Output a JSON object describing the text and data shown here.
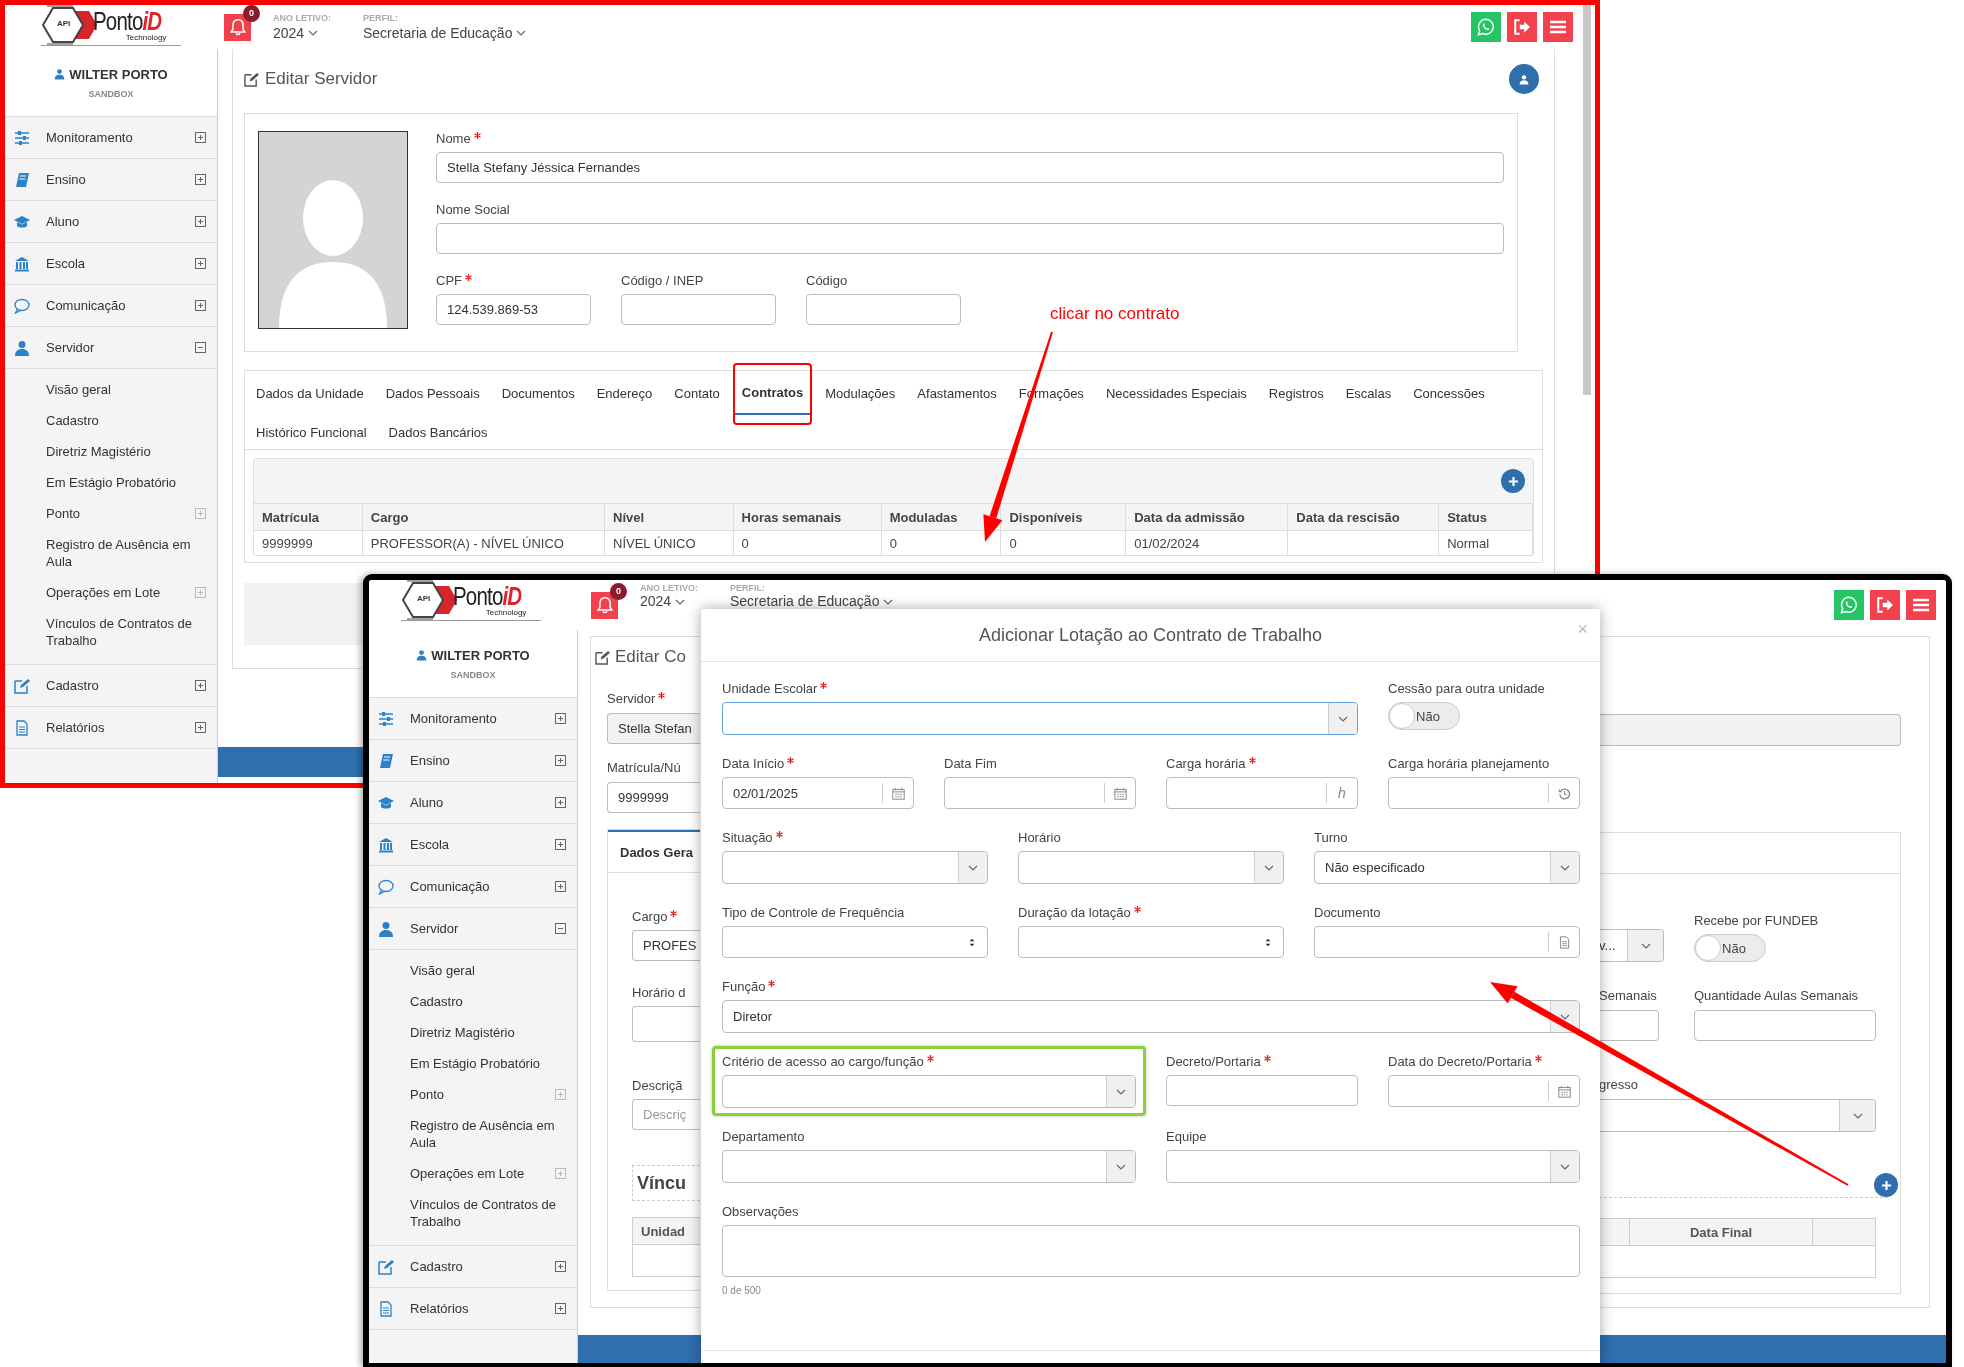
{
  "annotation": {
    "note": "clicar no contrato"
  },
  "back_screen": {
    "header": {
      "logo": {
        "badge": "API",
        "name": "Ponto",
        "accent": "iD",
        "tagline": "Technology"
      },
      "notifications": "0",
      "year_label": "ANO LETIVO:",
      "year": "2024",
      "profile_label": "PERFIL:",
      "profile": "Secretaria de Educação"
    },
    "sidebar": {
      "user": "WILTER PORTO",
      "environment": "SANDBOX",
      "items": [
        {
          "label": "Monitoramento",
          "expanded": false
        },
        {
          "label": "Ensino",
          "expanded": false
        },
        {
          "label": "Aluno",
          "expanded": false
        },
        {
          "label": "Escola",
          "expanded": false
        },
        {
          "label": "Comunicação",
          "expanded": false
        },
        {
          "label": "Servidor",
          "expanded": true,
          "children": [
            {
              "label": "Visão geral",
              "expandable": false
            },
            {
              "label": "Cadastro",
              "expandable": false
            },
            {
              "label": "Diretriz Magistério",
              "expandable": false
            },
            {
              "label": "Em Estágio Probatório",
              "expandable": false
            },
            {
              "label": "Ponto",
              "expandable": true
            },
            {
              "label": "Registro de Ausência em Aula",
              "expandable": false
            },
            {
              "label": "Operações em Lote",
              "expandable": true
            },
            {
              "label": "Vínculos de Contratos de Trabalho",
              "expandable": false
            }
          ]
        },
        {
          "label": "Cadastro",
          "expanded": false
        },
        {
          "label": "Relatórios",
          "expanded": false
        }
      ]
    },
    "page": {
      "title": "Editar Servidor",
      "fields": [
        {
          "label": "Nome",
          "required": true,
          "value": "Stella Stefany Jéssica Fernandes"
        },
        {
          "label": "Nome Social",
          "required": false
        },
        {
          "label": "CPF",
          "required": true,
          "value": "124.539.869-53"
        },
        {
          "label": "Código / INEP",
          "required": false
        },
        {
          "label": "Código",
          "required": false
        }
      ],
      "tabs": [
        {
          "label": "Dados da Unidade",
          "selected": false
        },
        {
          "label": "Dados Pessoais",
          "selected": false
        },
        {
          "label": "Documentos",
          "selected": false
        },
        {
          "label": "Endereço",
          "selected": false
        },
        {
          "label": "Contato",
          "selected": false
        },
        {
          "label": "Contratos",
          "selected": true
        },
        {
          "label": "Modulações",
          "selected": false
        },
        {
          "label": "Afastamentos",
          "selected": false
        },
        {
          "label": "Formações",
          "selected": false
        },
        {
          "label": "Necessidades Especiais",
          "selected": false
        },
        {
          "label": "Registros",
          "selected": false
        },
        {
          "label": "Escalas",
          "selected": false
        },
        {
          "label": "Concessões",
          "selected": false
        },
        {
          "label": "Histórico Funcional",
          "selected": false
        },
        {
          "label": "Dados Bancários",
          "selected": false
        }
      ],
      "table": {
        "columns": [
          "Matrícula",
          "Cargo",
          "Nível",
          "Horas semanais",
          "Moduladas",
          "Disponíveis",
          "Data da admissão",
          "Data da rescisão",
          "Status"
        ],
        "rows": [
          [
            "9999999",
            "PROFESSOR(A) - NÍVEL ÚNICO",
            "NÍVEL ÚNICO",
            "0",
            "0",
            "0",
            "01/02/2024",
            null,
            "Normal"
          ]
        ]
      }
    }
  },
  "front_screen": {
    "header": {
      "logo": {
        "badge": "API",
        "name": "Ponto",
        "accent": "iD",
        "tagline": "Technology"
      },
      "notifications": "0",
      "year_label": "ANO LETIVO:",
      "year": "2024",
      "profile_label": "PERFIL:",
      "profile": "Secretaria de Educação"
    },
    "sidebar": {
      "user": "WILTER PORTO",
      "environment": "SANDBOX",
      "items": [
        {
          "label": "Monitoramento",
          "expanded": false
        },
        {
          "label": "Ensino",
          "expanded": false
        },
        {
          "label": "Aluno",
          "expanded": false
        },
        {
          "label": "Escola",
          "expanded": false
        },
        {
          "label": "Comunicação",
          "expanded": false
        },
        {
          "label": "Servidor",
          "expanded": true,
          "children": [
            {
              "label": "Visão geral",
              "expandable": false
            },
            {
              "label": "Cadastro",
              "expandable": false
            },
            {
              "label": "Diretriz Magistério",
              "expandable": false
            },
            {
              "label": "Em Estágio Probatório",
              "expandable": false
            },
            {
              "label": "Ponto",
              "expandable": true
            },
            {
              "label": "Registro de Ausência em Aula",
              "expandable": false
            },
            {
              "label": "Operações em Lote",
              "expandable": true
            },
            {
              "label": "Vínculos de Contratos de Trabalho",
              "expandable": false
            }
          ]
        },
        {
          "label": "Cadastro",
          "expanded": false
        },
        {
          "label": "Relatórios",
          "expanded": false
        }
      ]
    },
    "page_left": {
      "title": "Editar Co",
      "fields": [
        {
          "label": "Servidor",
          "required": true,
          "value": "Stella Stefan"
        },
        {
          "label": "Matrícula/Nú",
          "required": false,
          "value": "9999999"
        }
      ],
      "tab": "Dados Gera",
      "tab_fields": [
        {
          "label": "Cargo",
          "required": true,
          "value": "PROFES"
        },
        {
          "label": "Horário d",
          "required": false
        },
        {
          "label": "Descriçã",
          "required": false,
          "placeholder": "Descriç"
        }
      ],
      "section": "Víncu",
      "table_column": "Unidad"
    },
    "page_right": {
      "select": {
        "value": "v..."
      },
      "toggle": {
        "label": "Recebe por FUNDEB",
        "value": "Não",
        "on": false
      },
      "fields": [
        {
          "label": "Semanais"
        },
        {
          "label": "Quantidade Aulas Semanais"
        }
      ],
      "select_2": {
        "label": "gresso"
      },
      "table_column": "Data Final"
    },
    "modal": {
      "title": "Adicionar Lotação ao Contrato de Trabalho",
      "close": "×",
      "fields": [
        {
          "label": "Unidade Escolar",
          "required": true,
          "kind": "select",
          "focused": true
        },
        {
          "label": "Cessão para outra unidade",
          "required": false,
          "kind": "toggle",
          "on": false,
          "value": "Não"
        },
        {
          "label": "Data Início",
          "required": true,
          "kind": "date",
          "value": "02/01/2025"
        },
        {
          "label": "Data Fim",
          "required": false,
          "kind": "date"
        },
        {
          "label": "Carga horária",
          "required": true,
          "kind": "hours",
          "unit": "h"
        },
        {
          "label": "Carga horária planejamento",
          "required": false,
          "kind": "history"
        },
        {
          "label": "Situação",
          "required": true,
          "kind": "select"
        },
        {
          "label": "Horário",
          "required": false,
          "kind": "select"
        },
        {
          "label": "Turno",
          "required": false,
          "kind": "select",
          "value": "Não especificado"
        },
        {
          "label": "Tipo de Controle de Frequência",
          "required": false,
          "kind": "spinner"
        },
        {
          "label": "Duração da lotação",
          "required": true,
          "kind": "spinner"
        },
        {
          "label": "Documento",
          "required": false,
          "kind": "document"
        },
        {
          "label": "Função",
          "required": true,
          "kind": "select",
          "value": "Diretor"
        },
        {
          "label": "Critério de acesso ao cargo/função",
          "required": true,
          "kind": "select"
        },
        {
          "label": "Decreto/Portaria",
          "required": true,
          "kind": "text"
        },
        {
          "label": "Data do Decreto/Portaria",
          "required": true,
          "kind": "date"
        },
        {
          "label": "Departamento",
          "required": false,
          "kind": "select"
        },
        {
          "label": "Equipe",
          "required": false,
          "kind": "select"
        },
        {
          "label": "Observações",
          "required": false,
          "kind": "textarea",
          "counter": "0 de 500"
        }
      ]
    }
  }
}
